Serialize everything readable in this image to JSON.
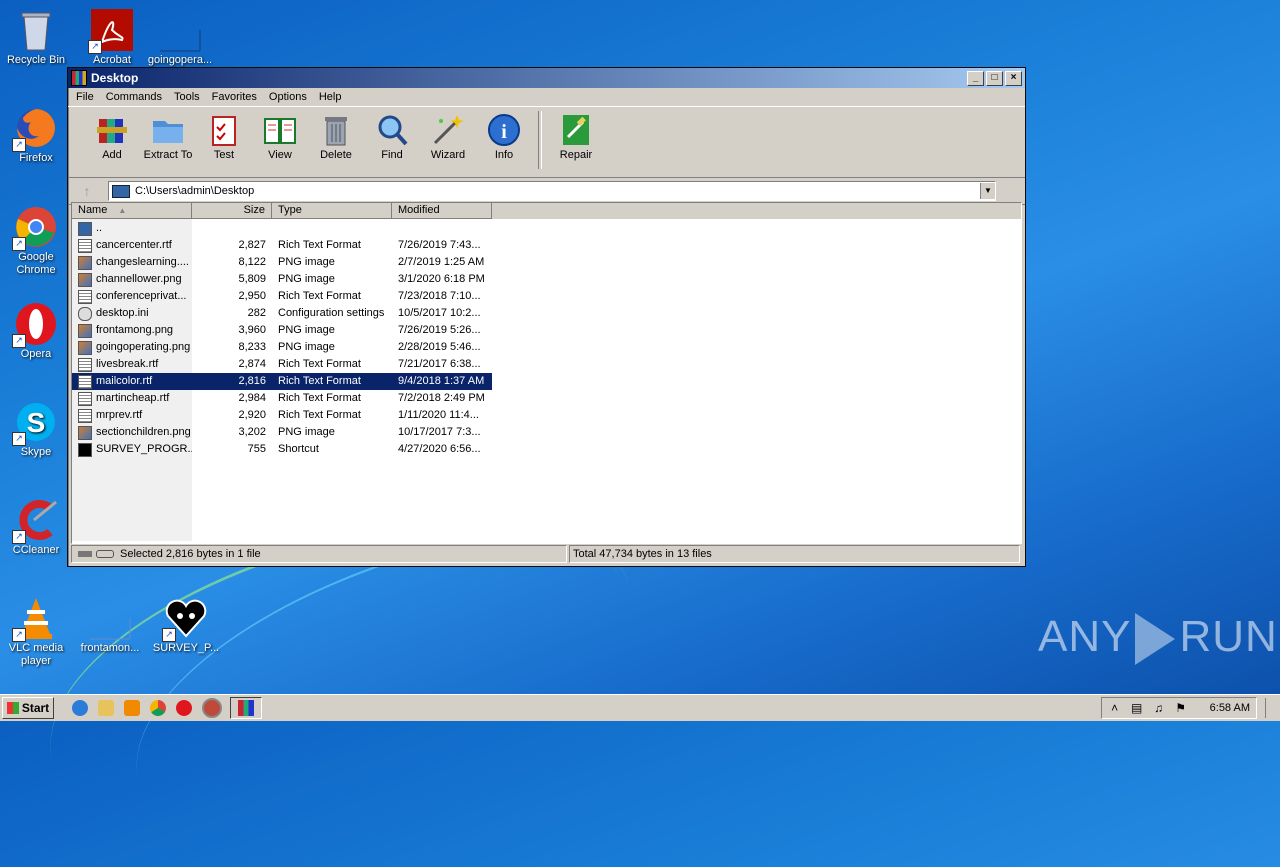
{
  "desktop": {
    "icons": [
      {
        "label": "Recycle Bin",
        "icon": "recycle-bin-icon"
      },
      {
        "label": "Acrobat",
        "icon": "acrobat-icon"
      },
      {
        "label": "goingopera...",
        "icon": "image-file-icon"
      },
      {
        "label": "Firefox",
        "icon": "firefox-icon"
      },
      {
        "label": "Google Chrome",
        "icon": "chrome-icon"
      },
      {
        "label": "Opera",
        "icon": "opera-icon"
      },
      {
        "label": "Skype",
        "icon": "skype-icon"
      },
      {
        "label": "CCleaner",
        "icon": "ccleaner-icon"
      },
      {
        "label": "VLC media player",
        "icon": "vlc-icon"
      },
      {
        "label": "frontamon...",
        "icon": "image-file-icon"
      },
      {
        "label": "SURVEY_P...",
        "icon": "heart-shortcut-icon"
      }
    ],
    "watermark": "ANY RUN"
  },
  "window": {
    "title": "Desktop",
    "title_buttons": {
      "minimize": "_",
      "maximize": "□",
      "close": "×"
    },
    "menu": [
      "File",
      "Commands",
      "Tools",
      "Favorites",
      "Options",
      "Help"
    ],
    "toolbar": [
      {
        "label": "Add",
        "icon": "add-archive-icon"
      },
      {
        "label": "Extract To",
        "icon": "extract-folder-icon"
      },
      {
        "label": "Test",
        "icon": "test-clipboard-icon"
      },
      {
        "label": "View",
        "icon": "view-book-icon"
      },
      {
        "label": "Delete",
        "icon": "trash-icon"
      },
      {
        "label": "Find",
        "icon": "magnifier-icon"
      },
      {
        "label": "Wizard",
        "icon": "wand-icon"
      },
      {
        "label": "Info",
        "icon": "info-icon"
      },
      {
        "label": "Repair",
        "icon": "repair-icon"
      }
    ],
    "address": "C:\\Users\\admin\\Desktop",
    "columns": {
      "name": "Name",
      "size": "Size",
      "type": "Type",
      "modified": "Modified"
    },
    "files": [
      {
        "name": "..",
        "size": "",
        "type": "",
        "modified": "",
        "icon": "up"
      },
      {
        "name": "cancercenter.rtf",
        "size": "2,827",
        "type": "Rich Text Format",
        "modified": "7/26/2019 7:43...",
        "icon": "rtf"
      },
      {
        "name": "changeslearning....",
        "size": "8,122",
        "type": "PNG image",
        "modified": "2/7/2019 1:25 AM",
        "icon": "png"
      },
      {
        "name": "channellower.png",
        "size": "5,809",
        "type": "PNG image",
        "modified": "3/1/2020 6:18 PM",
        "icon": "png"
      },
      {
        "name": "conferenceprivat...",
        "size": "2,950",
        "type": "Rich Text Format",
        "modified": "7/23/2018 7:10...",
        "icon": "rtf"
      },
      {
        "name": "desktop.ini",
        "size": "282",
        "type": "Configuration settings",
        "modified": "10/5/2017 10:2...",
        "icon": "ini"
      },
      {
        "name": "frontamong.png",
        "size": "3,960",
        "type": "PNG image",
        "modified": "7/26/2019 5:26...",
        "icon": "png"
      },
      {
        "name": "goingoperating.png",
        "size": "8,233",
        "type": "PNG image",
        "modified": "2/28/2019 5:46...",
        "icon": "png"
      },
      {
        "name": "livesbreak.rtf",
        "size": "2,874",
        "type": "Rich Text Format",
        "modified": "7/21/2017 6:38...",
        "icon": "rtf"
      },
      {
        "name": "mailcolor.rtf",
        "size": "2,816",
        "type": "Rich Text Format",
        "modified": "9/4/2018 1:37 AM",
        "icon": "rtf",
        "selected": true
      },
      {
        "name": "martincheap.rtf",
        "size": "2,984",
        "type": "Rich Text Format",
        "modified": "7/2/2018 2:49 PM",
        "icon": "rtf"
      },
      {
        "name": "mrprev.rtf",
        "size": "2,920",
        "type": "Rich Text Format",
        "modified": "1/11/2020 11:4...",
        "icon": "rtf"
      },
      {
        "name": "sectionchildren.png",
        "size": "3,202",
        "type": "PNG image",
        "modified": "10/17/2017 7:3...",
        "icon": "png"
      },
      {
        "name": "SURVEY_PROGR...",
        "size": "755",
        "type": "Shortcut",
        "modified": "4/27/2020 6:56...",
        "icon": "lnk"
      }
    ],
    "status_left": "Selected 2,816 bytes in 1 file",
    "status_right": "Total 47,734 bytes in 13 files"
  },
  "taskbar": {
    "start": "Start",
    "clock": "6:58 AM"
  }
}
